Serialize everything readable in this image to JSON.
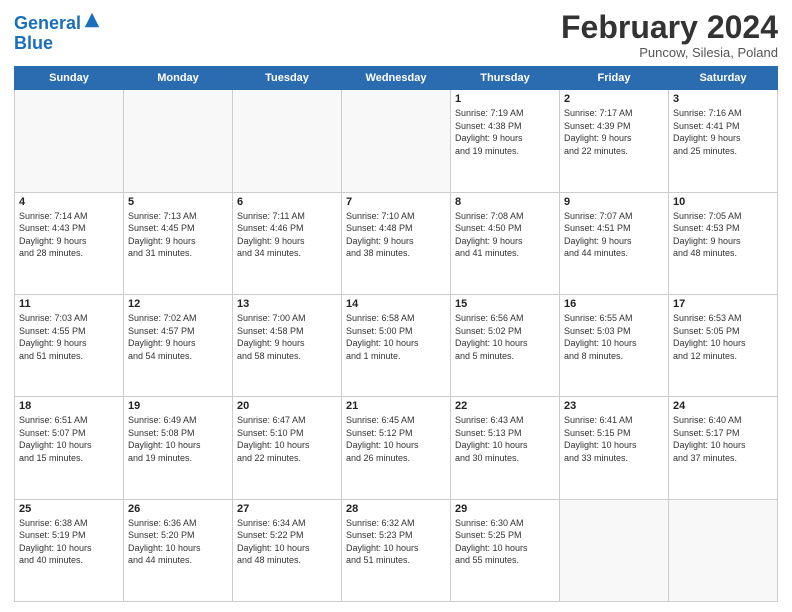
{
  "header": {
    "logo_line1": "General",
    "logo_line2": "Blue",
    "month_title": "February 2024",
    "location": "Puncow, Silesia, Poland"
  },
  "weekdays": [
    "Sunday",
    "Monday",
    "Tuesday",
    "Wednesday",
    "Thursday",
    "Friday",
    "Saturday"
  ],
  "weeks": [
    [
      {
        "day": "",
        "info": ""
      },
      {
        "day": "",
        "info": ""
      },
      {
        "day": "",
        "info": ""
      },
      {
        "day": "",
        "info": ""
      },
      {
        "day": "1",
        "info": "Sunrise: 7:19 AM\nSunset: 4:38 PM\nDaylight: 9 hours\nand 19 minutes."
      },
      {
        "day": "2",
        "info": "Sunrise: 7:17 AM\nSunset: 4:39 PM\nDaylight: 9 hours\nand 22 minutes."
      },
      {
        "day": "3",
        "info": "Sunrise: 7:16 AM\nSunset: 4:41 PM\nDaylight: 9 hours\nand 25 minutes."
      }
    ],
    [
      {
        "day": "4",
        "info": "Sunrise: 7:14 AM\nSunset: 4:43 PM\nDaylight: 9 hours\nand 28 minutes."
      },
      {
        "day": "5",
        "info": "Sunrise: 7:13 AM\nSunset: 4:45 PM\nDaylight: 9 hours\nand 31 minutes."
      },
      {
        "day": "6",
        "info": "Sunrise: 7:11 AM\nSunset: 4:46 PM\nDaylight: 9 hours\nand 34 minutes."
      },
      {
        "day": "7",
        "info": "Sunrise: 7:10 AM\nSunset: 4:48 PM\nDaylight: 9 hours\nand 38 minutes."
      },
      {
        "day": "8",
        "info": "Sunrise: 7:08 AM\nSunset: 4:50 PM\nDaylight: 9 hours\nand 41 minutes."
      },
      {
        "day": "9",
        "info": "Sunrise: 7:07 AM\nSunset: 4:51 PM\nDaylight: 9 hours\nand 44 minutes."
      },
      {
        "day": "10",
        "info": "Sunrise: 7:05 AM\nSunset: 4:53 PM\nDaylight: 9 hours\nand 48 minutes."
      }
    ],
    [
      {
        "day": "11",
        "info": "Sunrise: 7:03 AM\nSunset: 4:55 PM\nDaylight: 9 hours\nand 51 minutes."
      },
      {
        "day": "12",
        "info": "Sunrise: 7:02 AM\nSunset: 4:57 PM\nDaylight: 9 hours\nand 54 minutes."
      },
      {
        "day": "13",
        "info": "Sunrise: 7:00 AM\nSunset: 4:58 PM\nDaylight: 9 hours\nand 58 minutes."
      },
      {
        "day": "14",
        "info": "Sunrise: 6:58 AM\nSunset: 5:00 PM\nDaylight: 10 hours\nand 1 minute."
      },
      {
        "day": "15",
        "info": "Sunrise: 6:56 AM\nSunset: 5:02 PM\nDaylight: 10 hours\nand 5 minutes."
      },
      {
        "day": "16",
        "info": "Sunrise: 6:55 AM\nSunset: 5:03 PM\nDaylight: 10 hours\nand 8 minutes."
      },
      {
        "day": "17",
        "info": "Sunrise: 6:53 AM\nSunset: 5:05 PM\nDaylight: 10 hours\nand 12 minutes."
      }
    ],
    [
      {
        "day": "18",
        "info": "Sunrise: 6:51 AM\nSunset: 5:07 PM\nDaylight: 10 hours\nand 15 minutes."
      },
      {
        "day": "19",
        "info": "Sunrise: 6:49 AM\nSunset: 5:08 PM\nDaylight: 10 hours\nand 19 minutes."
      },
      {
        "day": "20",
        "info": "Sunrise: 6:47 AM\nSunset: 5:10 PM\nDaylight: 10 hours\nand 22 minutes."
      },
      {
        "day": "21",
        "info": "Sunrise: 6:45 AM\nSunset: 5:12 PM\nDaylight: 10 hours\nand 26 minutes."
      },
      {
        "day": "22",
        "info": "Sunrise: 6:43 AM\nSunset: 5:13 PM\nDaylight: 10 hours\nand 30 minutes."
      },
      {
        "day": "23",
        "info": "Sunrise: 6:41 AM\nSunset: 5:15 PM\nDaylight: 10 hours\nand 33 minutes."
      },
      {
        "day": "24",
        "info": "Sunrise: 6:40 AM\nSunset: 5:17 PM\nDaylight: 10 hours\nand 37 minutes."
      }
    ],
    [
      {
        "day": "25",
        "info": "Sunrise: 6:38 AM\nSunset: 5:19 PM\nDaylight: 10 hours\nand 40 minutes."
      },
      {
        "day": "26",
        "info": "Sunrise: 6:36 AM\nSunset: 5:20 PM\nDaylight: 10 hours\nand 44 minutes."
      },
      {
        "day": "27",
        "info": "Sunrise: 6:34 AM\nSunset: 5:22 PM\nDaylight: 10 hours\nand 48 minutes."
      },
      {
        "day": "28",
        "info": "Sunrise: 6:32 AM\nSunset: 5:23 PM\nDaylight: 10 hours\nand 51 minutes."
      },
      {
        "day": "29",
        "info": "Sunrise: 6:30 AM\nSunset: 5:25 PM\nDaylight: 10 hours\nand 55 minutes."
      },
      {
        "day": "",
        "info": ""
      },
      {
        "day": "",
        "info": ""
      }
    ]
  ]
}
